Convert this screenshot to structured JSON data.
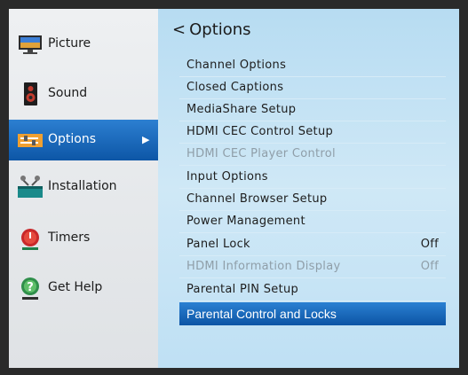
{
  "sidebar": {
    "items": [
      {
        "label": "Picture",
        "icon": "monitor-icon"
      },
      {
        "label": "Sound",
        "icon": "speaker-icon"
      },
      {
        "label": "Options",
        "icon": "sliders-icon",
        "active": true
      },
      {
        "label": "Installation",
        "icon": "satellite-dish-icon"
      },
      {
        "label": "Timers",
        "icon": "alarm-clock-icon"
      },
      {
        "label": "Get Help",
        "icon": "help-icon"
      }
    ],
    "active_arrow": "▶"
  },
  "main": {
    "title": "Options",
    "back_glyph": "<",
    "items": [
      {
        "label": "Channel Options",
        "value": ""
      },
      {
        "label": "Closed Captions",
        "value": ""
      },
      {
        "label": "MediaShare Setup",
        "value": ""
      },
      {
        "label": "HDMI CEC Control Setup",
        "value": ""
      },
      {
        "label": "HDMI CEC Player Control",
        "value": "",
        "disabled": true
      },
      {
        "label": "Input Options",
        "value": ""
      },
      {
        "label": "Channel Browser Setup",
        "value": ""
      },
      {
        "label": "Power Management",
        "value": ""
      },
      {
        "label": "Panel Lock",
        "value": "Off"
      },
      {
        "label": "HDMI Information Display",
        "value": "Off",
        "disabled": true
      },
      {
        "label": "Parental PIN Setup",
        "value": ""
      },
      {
        "label": "Parental Control and Locks",
        "value": "",
        "selected": true
      }
    ]
  },
  "colors": {
    "highlight": "#0d56a6",
    "menu_background": "#c4e3f5",
    "sidebar_background": "#e6e8eb",
    "disabled_text": "#8f9ea8"
  }
}
